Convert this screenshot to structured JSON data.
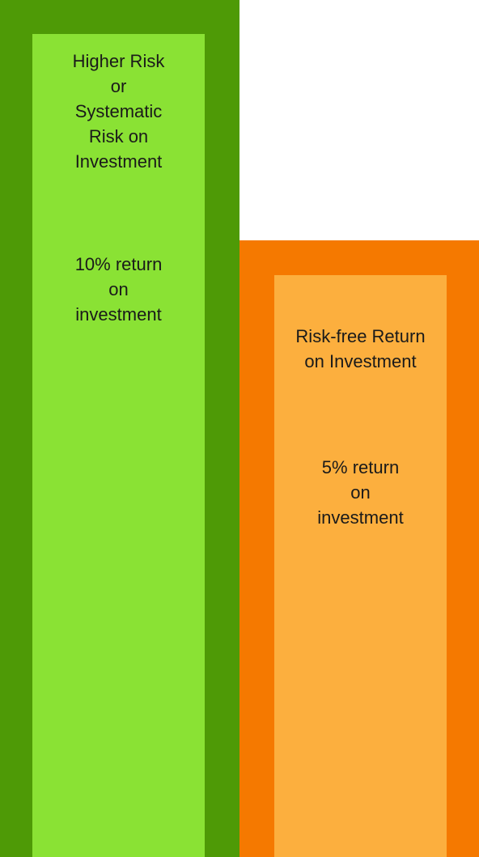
{
  "bars": [
    {
      "id": "high",
      "title": "Higher Risk\nor\nSystematic\nRisk on\nInvestment",
      "return_text": "10% return\non\ninvestment",
      "outer_color": "#4e9a06",
      "inner_color": "#8ae234"
    },
    {
      "id": "free",
      "title": "Risk-free Return\non Investment",
      "return_text": "5% return\non\ninvestment",
      "outer_color": "#f57900",
      "inner_color": "#fcaf3e"
    }
  ]
}
